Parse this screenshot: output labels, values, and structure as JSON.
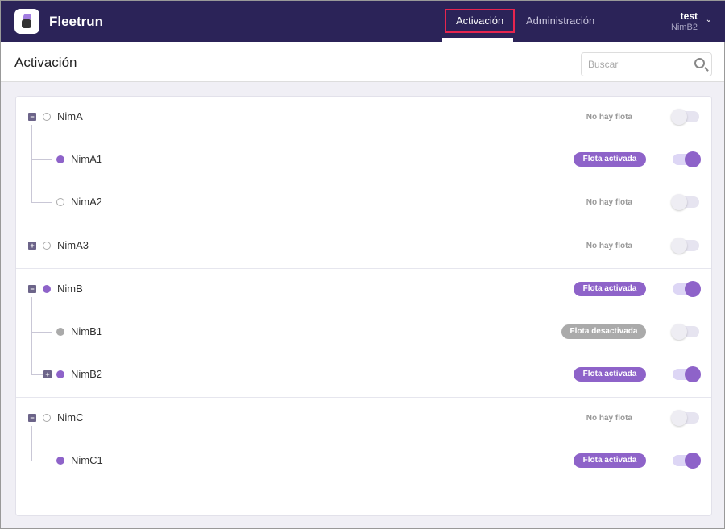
{
  "header": {
    "brand": "Fleetrun",
    "nav": [
      {
        "label": "Activación",
        "active": true
      },
      {
        "label": "Administración",
        "active": false
      }
    ],
    "user": {
      "name": "test",
      "account": "NimB2"
    }
  },
  "page": {
    "title": "Activación",
    "search_placeholder": "Buscar"
  },
  "status_labels": {
    "none": "No hay flota",
    "active": "Flota activada",
    "inactive": "Flota desactivada"
  },
  "groups": [
    {
      "rows": [
        {
          "name": "NimA",
          "level": 0,
          "expander": "minus",
          "dot": "off",
          "status": "none",
          "toggle": false
        },
        {
          "name": "NimA1",
          "level": 1,
          "expander": "",
          "dot": "on",
          "status": "active",
          "toggle": true
        },
        {
          "name": "NimA2",
          "level": 1,
          "expander": "",
          "dot": "off",
          "status": "none",
          "toggle": false
        }
      ]
    },
    {
      "rows": [
        {
          "name": "NimA3",
          "level": 0,
          "expander": "plus",
          "dot": "off",
          "status": "none",
          "toggle": false
        }
      ]
    },
    {
      "rows": [
        {
          "name": "NimB",
          "level": 0,
          "expander": "minus",
          "dot": "on",
          "status": "active",
          "toggle": true
        },
        {
          "name": "NimB1",
          "level": 1,
          "expander": "",
          "dot": "gray",
          "status": "inactive",
          "toggle": false
        },
        {
          "name": "NimB2",
          "level": 1,
          "expander": "plus",
          "dot": "on",
          "status": "active",
          "toggle": true
        }
      ]
    },
    {
      "rows": [
        {
          "name": "NimC",
          "level": 0,
          "expander": "minus",
          "dot": "off",
          "status": "none",
          "toggle": false
        },
        {
          "name": "NimC1",
          "level": 1,
          "expander": "",
          "dot": "on",
          "status": "active",
          "toggle": true
        }
      ]
    }
  ]
}
